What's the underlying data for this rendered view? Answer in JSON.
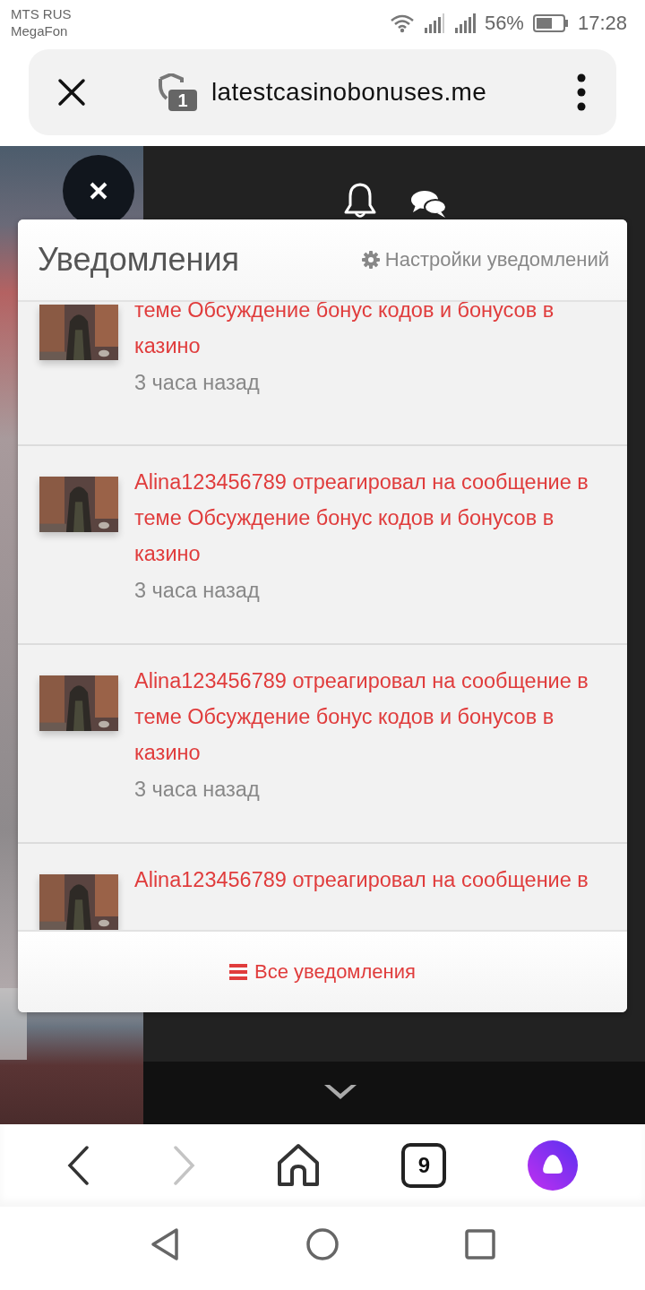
{
  "status_bar": {
    "carrier_1": "MTS RUS",
    "carrier_2": "MegaFon",
    "battery": "56%",
    "time": "17:28"
  },
  "address_bar": {
    "site_badge": "1",
    "url": "latestcasinobonuses.me"
  },
  "notifications": {
    "title": "Уведомления",
    "settings_link": "Настройки уведомлений",
    "items": [
      {
        "text": "теме Обсуждение бонус кодов и бонусов в казино",
        "time": "3 часа назад"
      },
      {
        "text": "Alina123456789 отреагировал на сообщение в теме Обсуждение бонус кодов и бонусов в казино",
        "time": "3 часа назад"
      },
      {
        "text": "Alina123456789 отреагировал на сообщение в теме Обсуждение бонус кодов и бонусов в казино",
        "time": "3 часа назад"
      },
      {
        "text": "Alina123456789 отреагировал на сообщение в"
      }
    ],
    "footer_link": "Все уведомления"
  },
  "browser_toolbar": {
    "forward_disabled": true,
    "tab_count": "9"
  }
}
